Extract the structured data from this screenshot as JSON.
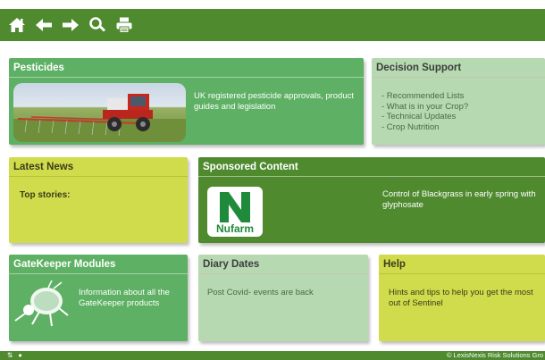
{
  "toolbar": {
    "icons": [
      "home-icon",
      "back-arrow-icon",
      "forward-arrow-icon",
      "search-icon",
      "print-icon"
    ],
    "color": "#4f8a2f"
  },
  "pesticides": {
    "title": "Pesticides",
    "description": "UK registered pesticide approvals, product guides and legislation"
  },
  "decision_support": {
    "title": "Decision Support",
    "items": [
      "- Recommended Lists",
      "- What is in your Crop?",
      "- Technical Updates",
      "- Crop Nutrition"
    ]
  },
  "latest_news": {
    "title": "Latest News",
    "text": "Top stories:"
  },
  "sponsored": {
    "title": "Sponsored Content",
    "logo_text": "Nufarm",
    "text": "Control of Blackgrass in early spring with glyphosate"
  },
  "gatekeeper": {
    "title": "GateKeeper Modules",
    "text": "Information about all the GateKeeper products"
  },
  "diary": {
    "title": "Diary Dates",
    "text": "Post Covid- events are back"
  },
  "help": {
    "title": "Help",
    "text": "Hints and tips to help you get the most out of Sentinel"
  },
  "footer": {
    "copyright": "©  LexisNexis Risk Solutions Gro"
  },
  "colors": {
    "dark_green": "#4f8a2f",
    "mid_green": "#5eb064",
    "light_green": "#b6d9b1",
    "yellow_green": "#d0dc4b"
  }
}
